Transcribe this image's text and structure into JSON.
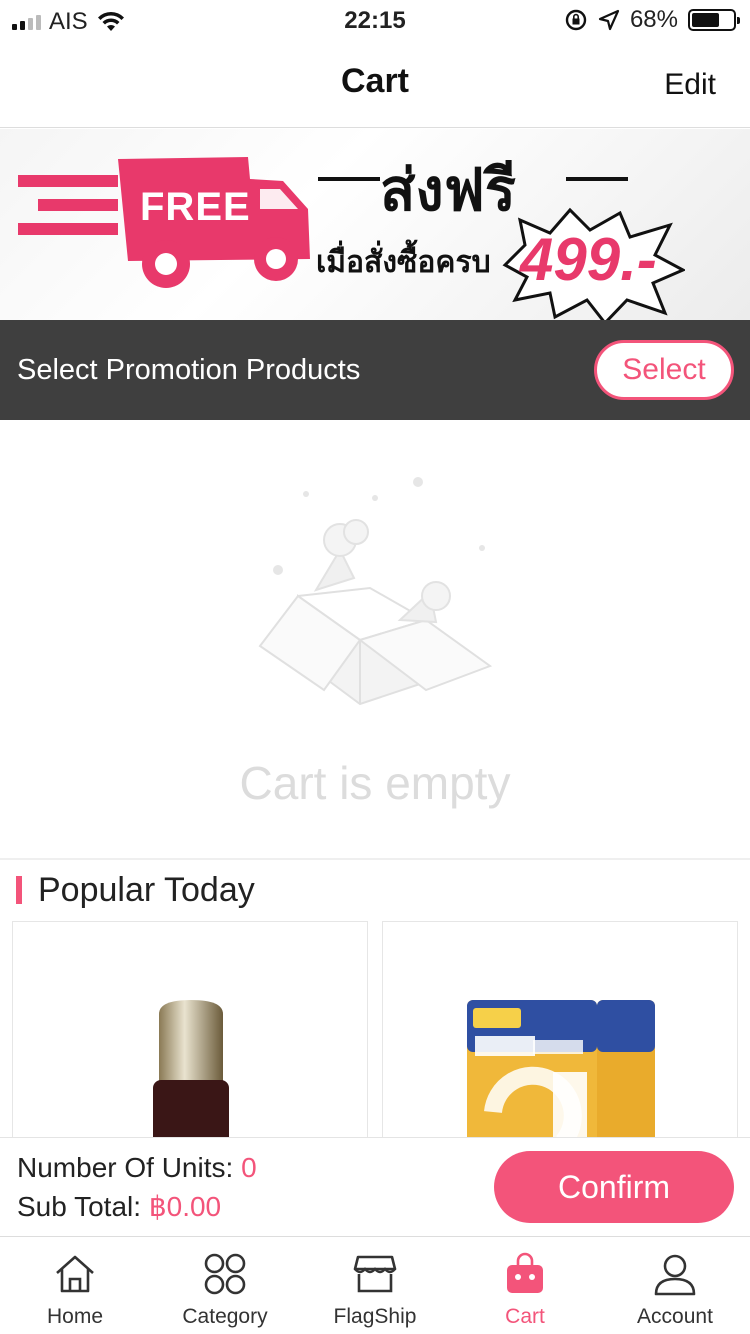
{
  "status_bar": {
    "carrier": "AIS",
    "time": "22:15",
    "battery_percent": "68%",
    "battery_level": 0.68
  },
  "nav": {
    "title": "Cart",
    "edit_label": "Edit"
  },
  "banner": {
    "truck_label": "FREE",
    "headline": "ส่งฟรี",
    "subline": "เมื่อสั่งซื้อครบ",
    "price": "499.-"
  },
  "promotion": {
    "label": "Select Promotion Products",
    "button_label": "Select"
  },
  "empty_cart": {
    "message": "Cart is empty"
  },
  "popular": {
    "title": "Popular Today"
  },
  "checkout": {
    "units_label": "Number Of Units:",
    "units_value": "0",
    "subtotal_label": "Sub Total:",
    "subtotal_value": "฿0.00",
    "confirm_label": "Confirm"
  },
  "tabs": [
    {
      "label": "Home",
      "icon": "home-icon"
    },
    {
      "label": "Category",
      "icon": "category-icon"
    },
    {
      "label": "FlagShip",
      "icon": "store-icon"
    },
    {
      "label": "Cart",
      "icon": "cart-bag-icon",
      "active": true
    },
    {
      "label": "Account",
      "icon": "account-icon"
    }
  ],
  "colors": {
    "accent": "#f3547a",
    "promo_bar": "#3f3f3f"
  }
}
